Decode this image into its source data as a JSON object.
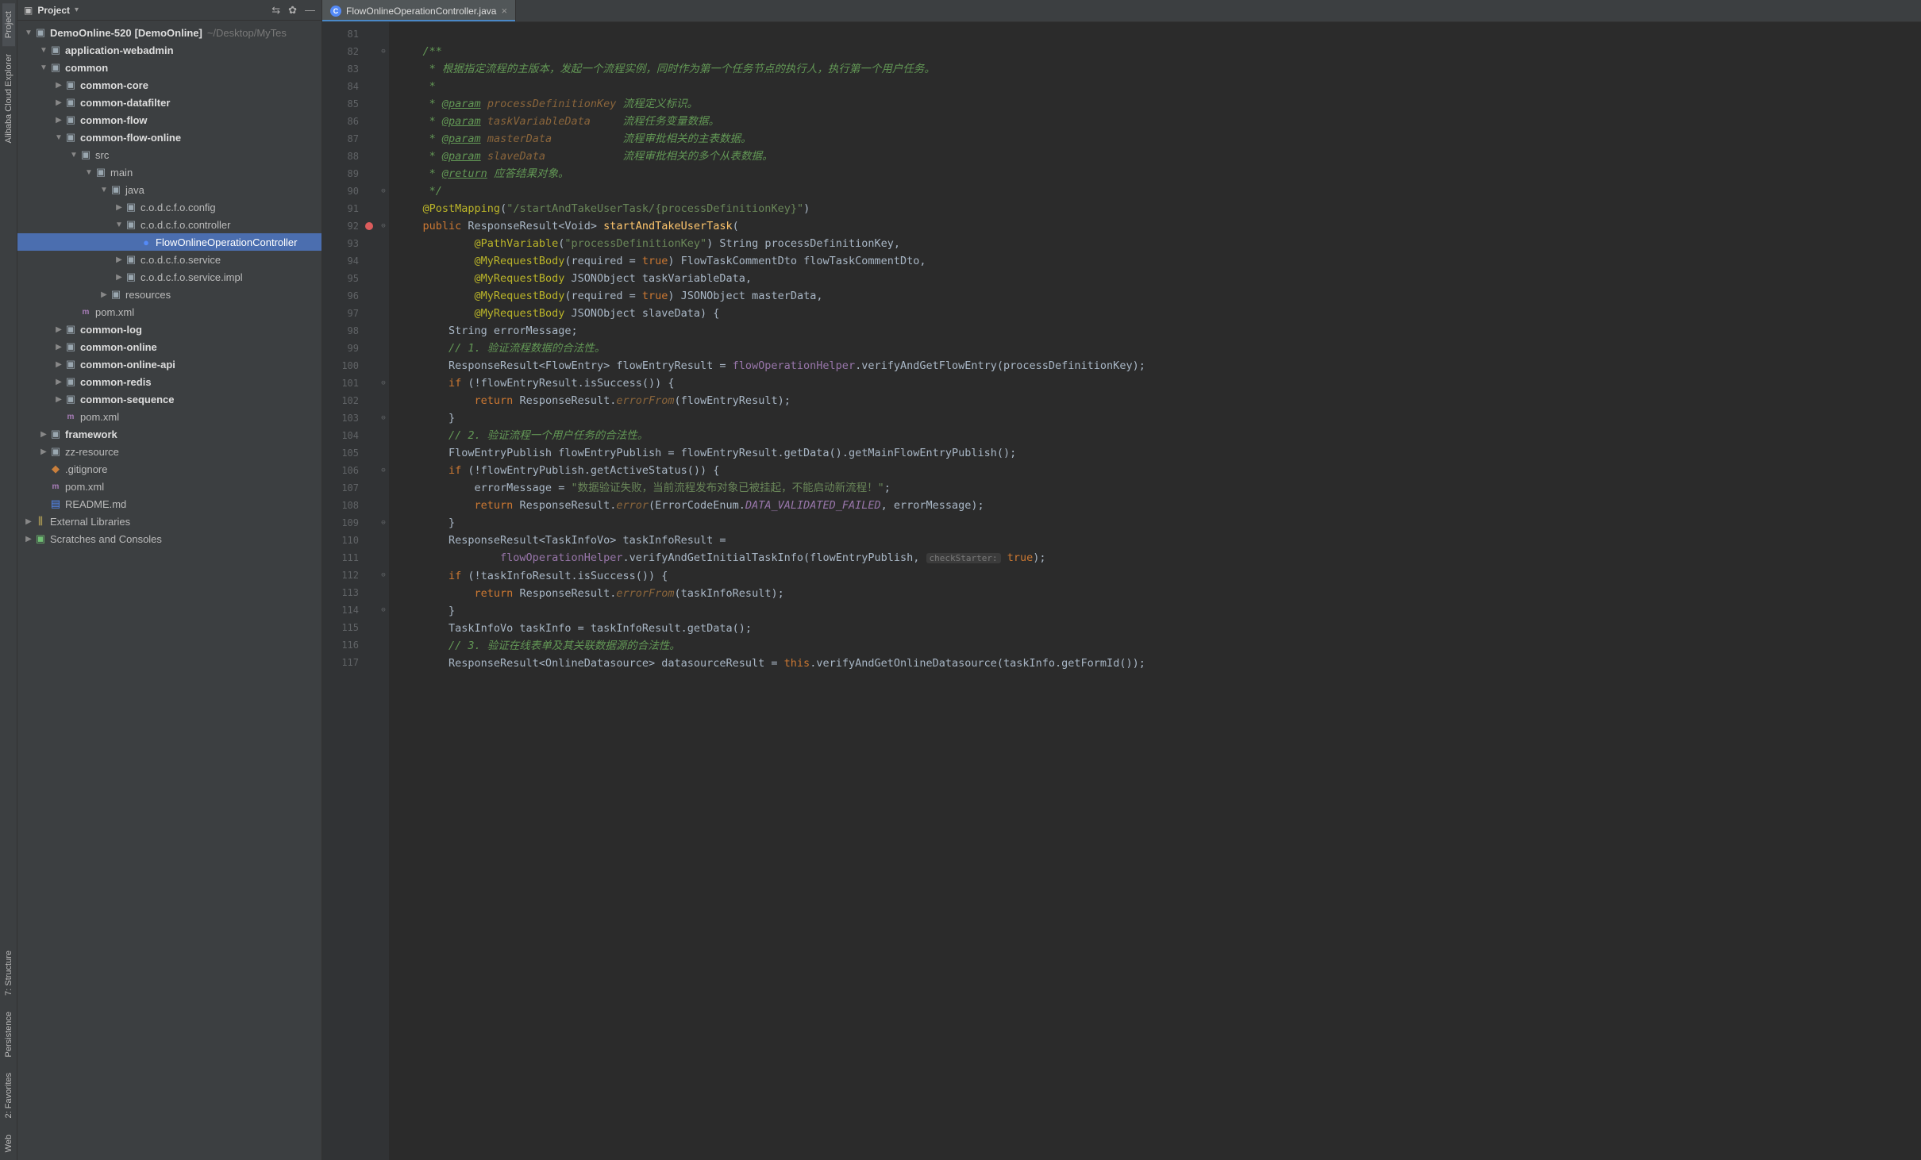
{
  "left_tabs": {
    "project": "Project",
    "alibaba": "Alibaba Cloud Explorer",
    "structure": "7: Structure",
    "persistence": "Persistence",
    "favorites": "2: Favorites",
    "web": "Web"
  },
  "project_panel": {
    "title": "Project",
    "root": {
      "name": "DemoOnline-520",
      "bracket": "[DemoOnline]",
      "path": "~/Desktop/MyTes"
    }
  },
  "tree": [
    {
      "indent": 0,
      "arrow": "down",
      "icon": "folder",
      "label": "application-webadmin",
      "bold": true
    },
    {
      "indent": 0,
      "arrow": "down",
      "icon": "folder",
      "label": "common",
      "bold": true
    },
    {
      "indent": 1,
      "arrow": "right",
      "icon": "folder",
      "label": "common-core",
      "bold": true
    },
    {
      "indent": 1,
      "arrow": "right",
      "icon": "folder",
      "label": "common-datafilter",
      "bold": true
    },
    {
      "indent": 1,
      "arrow": "right",
      "icon": "folder",
      "label": "common-flow",
      "bold": true
    },
    {
      "indent": 1,
      "arrow": "down",
      "icon": "folder",
      "label": "common-flow-online",
      "bold": true
    },
    {
      "indent": 2,
      "arrow": "down",
      "icon": "folder",
      "label": "src"
    },
    {
      "indent": 3,
      "arrow": "down",
      "icon": "folder",
      "label": "main"
    },
    {
      "indent": 4,
      "arrow": "down",
      "icon": "folder",
      "label": "java"
    },
    {
      "indent": 5,
      "arrow": "right",
      "icon": "pkg",
      "label": "c.o.d.c.f.o.config"
    },
    {
      "indent": 5,
      "arrow": "down",
      "icon": "pkg",
      "label": "c.o.d.c.f.o.controller"
    },
    {
      "indent": 6,
      "arrow": "none",
      "icon": "java",
      "label": "FlowOnlineOperationController",
      "selected": true
    },
    {
      "indent": 5,
      "arrow": "right",
      "icon": "pkg",
      "label": "c.o.d.c.f.o.service"
    },
    {
      "indent": 5,
      "arrow": "right",
      "icon": "pkg",
      "label": "c.o.d.c.f.o.service.impl"
    },
    {
      "indent": 4,
      "arrow": "right",
      "icon": "folder",
      "label": "resources"
    },
    {
      "indent": 2,
      "arrow": "none",
      "icon": "xml",
      "label": "pom.xml"
    },
    {
      "indent": 1,
      "arrow": "right",
      "icon": "folder",
      "label": "common-log",
      "bold": true
    },
    {
      "indent": 1,
      "arrow": "right",
      "icon": "folder",
      "label": "common-online",
      "bold": true
    },
    {
      "indent": 1,
      "arrow": "right",
      "icon": "folder",
      "label": "common-online-api",
      "bold": true
    },
    {
      "indent": 1,
      "arrow": "right",
      "icon": "folder",
      "label": "common-redis",
      "bold": true
    },
    {
      "indent": 1,
      "arrow": "right",
      "icon": "folder",
      "label": "common-sequence",
      "bold": true
    },
    {
      "indent": 1,
      "arrow": "none",
      "icon": "xml",
      "label": "pom.xml"
    },
    {
      "indent": 0,
      "arrow": "right",
      "icon": "folder",
      "label": "framework",
      "bold": true
    },
    {
      "indent": 0,
      "arrow": "right",
      "icon": "folder",
      "label": "zz-resource"
    },
    {
      "indent": 0,
      "arrow": "none",
      "icon": "git",
      "label": ".gitignore"
    },
    {
      "indent": 0,
      "arrow": "none",
      "icon": "xml",
      "label": "pom.xml"
    },
    {
      "indent": 0,
      "arrow": "none",
      "icon": "md",
      "label": "README.md"
    }
  ],
  "tree_footer": [
    {
      "icon": "lib",
      "label": "External Libraries"
    },
    {
      "icon": "scratch",
      "label": "Scratches and Consoles"
    }
  ],
  "editor_tab": {
    "name": "FlowOnlineOperationController.java"
  },
  "code_lines": [
    {
      "n": 81,
      "fold": "",
      "html": ""
    },
    {
      "n": 82,
      "fold": "⊖",
      "html": "    <span class='c-comment'>/**</span>"
    },
    {
      "n": 83,
      "fold": "",
      "html": "<span class='c-comment'>     * 根据指定流程的主版本，发起一个流程实例，同时作为第一个任务节点的执行人，执行第一个用户任务。</span>"
    },
    {
      "n": 84,
      "fold": "",
      "html": "<span class='c-comment'>     *</span>"
    },
    {
      "n": 85,
      "fold": "",
      "html": "<span class='c-comment'>     * <span class='c-doctag'>@param</span> <span class='c-docparam'>processDefinitionKey</span> 流程定义标识。</span>"
    },
    {
      "n": 86,
      "fold": "",
      "html": "<span class='c-comment'>     * <span class='c-doctag'>@param</span> <span class='c-docparam'>taskVariableData</span>     流程任务变量数据。</span>"
    },
    {
      "n": 87,
      "fold": "",
      "html": "<span class='c-comment'>     * <span class='c-doctag'>@param</span> <span class='c-docparam'>masterData</span>           流程审批相关的主表数据。</span>"
    },
    {
      "n": 88,
      "fold": "",
      "html": "<span class='c-comment'>     * <span class='c-doctag'>@param</span> <span class='c-docparam'>slaveData</span>            流程审批相关的多个从表数据。</span>"
    },
    {
      "n": 89,
      "fold": "",
      "html": "<span class='c-comment'>     * <span class='c-doctag'>@return</span> 应答结果对象。</span>"
    },
    {
      "n": 90,
      "fold": "⊖",
      "html": "<span class='c-comment'>     */</span>"
    },
    {
      "n": 91,
      "fold": "",
      "html": "    <span class='c-ann'>@PostMapping</span>(<span class='c-str'>\"/startAndTakeUserTask/{processDefinitionKey}\"</span>)"
    },
    {
      "n": 92,
      "fold": "⊖",
      "bp": true,
      "html": "    <span class='c-kw'>public</span> ResponseResult&lt;Void&gt; <span class='c-method'>startAndTakeUserTask</span>("
    },
    {
      "n": 93,
      "fold": "",
      "html": "            <span class='c-ann'>@PathVariable</span>(<span class='c-str'>\"processDefinitionKey\"</span>) String processDefinitionKey,"
    },
    {
      "n": 94,
      "fold": "",
      "html": "            <span class='c-ann'>@MyRequestBody</span>(required = <span class='c-kw'>true</span>) FlowTaskCommentDto flowTaskCommentDto,"
    },
    {
      "n": 95,
      "fold": "",
      "html": "            <span class='c-ann'>@MyRequestBody</span> JSONObject taskVariableData,"
    },
    {
      "n": 96,
      "fold": "",
      "html": "            <span class='c-ann'>@MyRequestBody</span>(required = <span class='c-kw'>true</span>) JSONObject masterData,"
    },
    {
      "n": 97,
      "fold": "",
      "html": "            <span class='c-ann'>@MyRequestBody</span> JSONObject slaveData) {"
    },
    {
      "n": 98,
      "fold": "",
      "html": "        String errorMessage;"
    },
    {
      "n": 99,
      "fold": "",
      "html": "        <span class='c-comment'>// 1. 验证流程数据的合法性。</span>"
    },
    {
      "n": 100,
      "fold": "",
      "html": "        ResponseResult&lt;FlowEntry&gt; flowEntryResult = <span class='c-field'>flowOperationHelper</span>.verifyAndGetFlowEntry(processDefinitionKey);"
    },
    {
      "n": 101,
      "fold": "⊖",
      "html": "        <span class='c-kw'>if</span> (!flowEntryResult.isSuccess()) {"
    },
    {
      "n": 102,
      "fold": "",
      "html": "            <span class='c-kw'>return</span> ResponseResult.<span class='c-docparam'>errorFrom</span>(flowEntryResult);"
    },
    {
      "n": 103,
      "fold": "⊖",
      "html": "        }"
    },
    {
      "n": 104,
      "fold": "",
      "html": "        <span class='c-comment'>// 2. 验证流程一个用户任务的合法性。</span>"
    },
    {
      "n": 105,
      "fold": "",
      "html": "        FlowEntryPublish flowEntryPublish = flowEntryResult.getData().getMainFlowEntryPublish();"
    },
    {
      "n": 106,
      "fold": "⊖",
      "html": "        <span class='c-kw'>if</span> (!flowEntryPublish.getActiveStatus()) {"
    },
    {
      "n": 107,
      "fold": "",
      "html": "            errorMessage = <span class='c-str'>\"数据验证失败，当前流程发布对象已被挂起，不能启动新流程！\"</span>;"
    },
    {
      "n": 108,
      "fold": "",
      "html": "            <span class='c-kw'>return</span> ResponseResult.<span class='c-docparam'>error</span>(ErrorCodeEnum.<span class='c-const'>DATA_VALIDATED_FAILED</span>, errorMessage);"
    },
    {
      "n": 109,
      "fold": "⊖",
      "html": "        }"
    },
    {
      "n": 110,
      "fold": "",
      "html": "        ResponseResult&lt;TaskInfoVo&gt; taskInfoResult ="
    },
    {
      "n": 111,
      "fold": "",
      "html": "                <span class='c-field'>flowOperationHelper</span>.verifyAndGetInitialTaskInfo(flowEntryPublish, <span class='c-hint'>checkStarter:</span> <span class='c-kw'>true</span>);"
    },
    {
      "n": 112,
      "fold": "⊖",
      "html": "        <span class='c-kw'>if</span> (!taskInfoResult.isSuccess()) {"
    },
    {
      "n": 113,
      "fold": "",
      "html": "            <span class='c-kw'>return</span> ResponseResult.<span class='c-docparam'>errorFrom</span>(taskInfoResult);"
    },
    {
      "n": 114,
      "fold": "⊖",
      "html": "        }"
    },
    {
      "n": 115,
      "fold": "",
      "html": "        TaskInfoVo taskInfo = taskInfoResult.getData();"
    },
    {
      "n": 116,
      "fold": "",
      "html": "        <span class='c-comment'>// 3. 验证在线表单及其关联数据源的合法性。</span>"
    },
    {
      "n": 117,
      "fold": "",
      "html": "        ResponseResult&lt;OnlineDatasource&gt; datasourceResult = <span class='c-kw'>this</span>.verifyAndGetOnlineDatasource(taskInfo.getFormId());"
    }
  ]
}
